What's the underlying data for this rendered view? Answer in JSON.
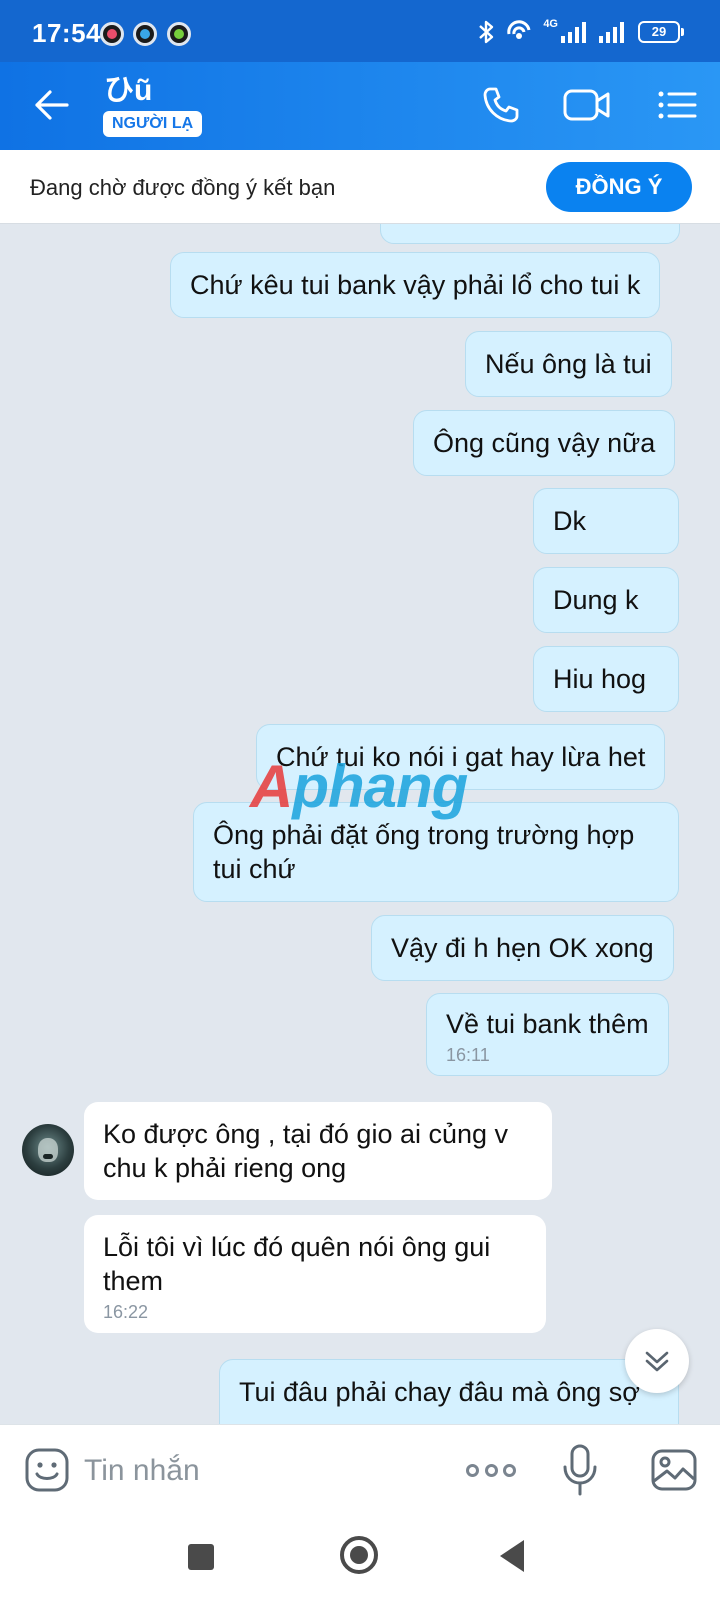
{
  "status_bar": {
    "time": "17:54",
    "network": "4G",
    "battery": "29"
  },
  "header": {
    "contact_name": "ひũ",
    "badge": "NGƯỜI LẠ"
  },
  "friend_request": {
    "text": "Đang chờ được đồng ý kết bạn",
    "accept_label": "ĐỒNG Ý"
  },
  "messages": [
    {
      "side": "sent",
      "text": "Chứ kêu tui bank vậy phải lổ cho tui k"
    },
    {
      "side": "sent",
      "text": "Nếu ông là tui"
    },
    {
      "side": "sent",
      "text": "Ông cũng vậy nữa"
    },
    {
      "side": "sent",
      "text": "Dk"
    },
    {
      "side": "sent",
      "text": "Dung k"
    },
    {
      "side": "sent",
      "text": "Hiu hog"
    },
    {
      "side": "sent",
      "text": "Chứ tui ko nói i gat hay lừa het"
    },
    {
      "side": "sent",
      "lines": [
        "Ông phải đặt ống trong trường hợp",
        "tui chứ"
      ]
    },
    {
      "side": "sent",
      "text": "Vậy đi h hẹn OK xong"
    },
    {
      "side": "sent",
      "text": "Về tui bank thêm",
      "time": "16:11"
    },
    {
      "side": "received",
      "lines": [
        "Ko được ông , tại đó gio ai củng v",
        "chu k phải rieng ong"
      ]
    },
    {
      "side": "received",
      "lines": [
        "Lỗi tôi vì  lúc đó quên nói ông gui",
        "them"
      ],
      "time": "16:22"
    },
    {
      "side": "sent",
      "text": "Tui đâu phải chay đâu mà ông sợ"
    }
  ],
  "watermark": {
    "part1": "A",
    "part2": "phang"
  },
  "input": {
    "placeholder": "Tin nhắn"
  },
  "colors": {
    "header_start": "#0f72e4",
    "header_end": "#2a97f5",
    "sent_bubble": "#d5f1ff",
    "received_bubble": "#ffffff",
    "chat_background": "#e1e7ee",
    "accent": "#0a82f0"
  },
  "icons": {
    "back": "arrow-left-icon",
    "call": "phone-icon",
    "video": "video-camera-icon",
    "menu": "list-menu-icon",
    "emoji": "emoji-icon",
    "more": "more-dots-icon",
    "mic": "microphone-icon",
    "image": "image-icon",
    "scroll": "chevron-double-down-icon"
  }
}
